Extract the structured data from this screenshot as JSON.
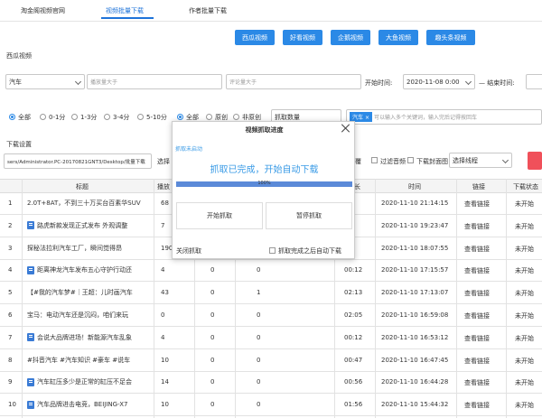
{
  "tabs": [
    {
      "label": "淘金阁视频官网"
    },
    {
      "label": "视频批量下载"
    },
    {
      "label": "作者批量下载"
    }
  ],
  "platform_buttons": [
    "西瓜视频",
    "好看视频",
    "企鹅视频",
    "大鱼视频",
    "趣头条视频"
  ],
  "section_xigua": "西瓜视频",
  "search": {
    "keyword_value": "汽车",
    "play_placeholder": "播放量大于",
    "comment_placeholder": "评论量大于",
    "start_label": "开始时间:",
    "start_value": "2020-11-08 0:00",
    "end_label": "结束时间:"
  },
  "duration_filters": [
    "全部",
    "0-1分",
    "1-3分",
    "3-4分",
    "5-10分"
  ],
  "original_filters": [
    "全部",
    "原创",
    "非原创"
  ],
  "capture_count_placeholder": "抓取数量",
  "keyword_tag": "汽车",
  "keyword_placeholder": "可以输入多个关键词，输入完后记得按回车",
  "download_settings_label": "下载设置",
  "download_path": "sers/Administrator.PC-20170821GNT3/Desktop/批量下载",
  "select_label": "选择",
  "right_options": [
    "过滤",
    "过滤音频",
    "下载封面图"
  ],
  "thread_select": "选择线程",
  "table": {
    "headers": {
      "title": "标题",
      "play": "播放",
      "t": "长",
      "time": "时间",
      "link": "链接",
      "status": "下载状态"
    },
    "rows": [
      {
        "num": "1",
        "title": "2.0T+8AT，不到三十万买台百素华SUV",
        "icon": false,
        "play": "68",
        "c1": "",
        "c2": "",
        "dur": "",
        "time": "2020-11-10 21:14:15",
        "link": "查看链接",
        "status": "未开始"
      },
      {
        "num": "2",
        "title": "路虎新款发现正式发布 外观调整",
        "icon": true,
        "play": "7",
        "c1": "",
        "c2": "",
        "dur": "",
        "time": "2020-11-10 19:23:47",
        "link": "查看链接",
        "status": "未开始"
      },
      {
        "num": "3",
        "title": "探秘法拉利汽车工厂，瞬间觉得昂",
        "icon": false,
        "play": "190",
        "c1": "",
        "c2": "",
        "dur": "",
        "time": "2020-11-10 18:07:55",
        "link": "查看链接",
        "status": "未开始"
      },
      {
        "num": "4",
        "title": "距离神龙汽车发布五心守护行动还",
        "icon": true,
        "play": "4",
        "c1": "0",
        "c2": "0",
        "dur": "00:12",
        "time": "2020-11-10 17:15:57",
        "link": "查看链接",
        "status": "未开始"
      },
      {
        "num": "5",
        "title": "【#我的汽车梦#｜王超：儿时画汽车",
        "icon": false,
        "play": "43",
        "c1": "0",
        "c2": "1",
        "dur": "02:13",
        "time": "2020-11-10 17:13:07",
        "link": "查看链接",
        "status": "未开始"
      },
      {
        "num": "6",
        "title": "宝马：电动汽车还是沉闷，咱们来玩",
        "icon": false,
        "play": "0",
        "c1": "0",
        "c2": "0",
        "dur": "02:05",
        "time": "2020-11-10 16:59:08",
        "link": "查看链接",
        "status": "未开始"
      },
      {
        "num": "7",
        "title": "会说大品牌进场！新能源汽车乱象",
        "icon": true,
        "play": "4",
        "c1": "0",
        "c2": "0",
        "dur": "00:12",
        "time": "2020-11-10 16:53:12",
        "link": "查看链接",
        "status": "未开始"
      },
      {
        "num": "8",
        "title": "#抖音汽车 #汽车知识 #豪车 #说车",
        "icon": false,
        "play": "10",
        "c1": "0",
        "c2": "0",
        "dur": "00:47",
        "time": "2020-11-10 16:47:45",
        "link": "查看链接",
        "status": "未开始"
      },
      {
        "num": "9",
        "title": "汽车缸压多少是正常的缸压不足会",
        "icon": true,
        "play": "14",
        "c1": "0",
        "c2": "0",
        "dur": "00:56",
        "time": "2020-11-10 16:44:28",
        "link": "查看链接",
        "status": "未开始"
      },
      {
        "num": "10",
        "title": "汽车品牌进击电竞，BEIJING-X7",
        "icon": true,
        "play": "10",
        "c1": "0",
        "c2": "0",
        "dur": "01:56",
        "time": "2020-11-10 15:44:32",
        "link": "查看链接",
        "status": "未开始"
      }
    ]
  },
  "modal": {
    "title": "视频抓取进度",
    "status_small": "抓取未启动",
    "status_big": "抓取已完成，开始自动下载",
    "progress": 100,
    "progress_text": "100%",
    "start_btn": "开始抓取",
    "pause_btn": "暂停抓取",
    "close_capture": "关闭抓取",
    "auto_download": "抓取完成之后自动下载"
  },
  "colors": {
    "accent": "#2b89e6",
    "red": "#f0505a"
  }
}
